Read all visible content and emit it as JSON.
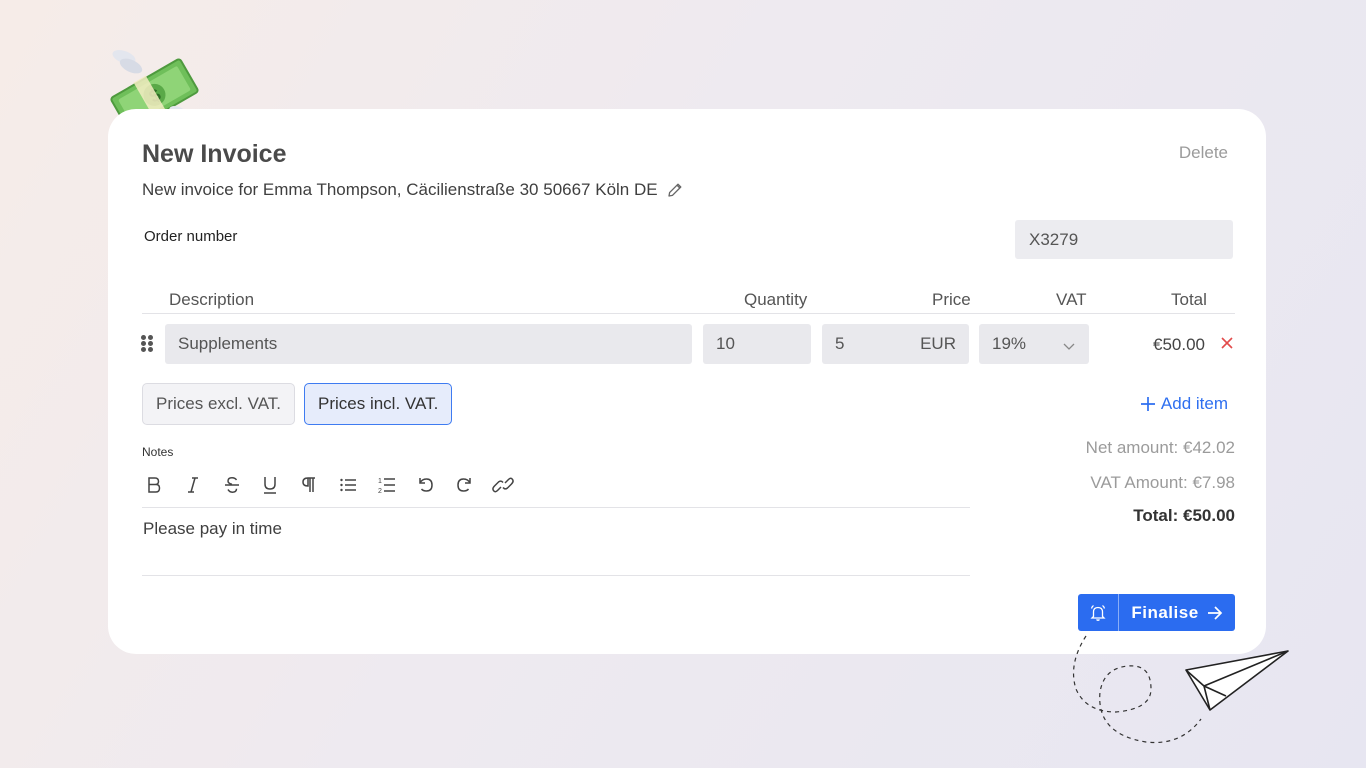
{
  "page": {
    "title": "New Invoice",
    "delete_label": "Delete",
    "subtitle": "New invoice for Emma Thompson, Cäcilienstraße 30 50667 Köln DE",
    "order_label": "Order number",
    "order_value": "X3279"
  },
  "table": {
    "headers": {
      "description": "Description",
      "quantity": "Quantity",
      "price": "Price",
      "vat": "VAT",
      "total": "Total"
    },
    "rows": [
      {
        "description": "Supplements",
        "quantity": "10",
        "price": "5",
        "currency": "EUR",
        "vat": "19%",
        "total": "€50.00"
      }
    ]
  },
  "pricing": {
    "excl_label": "Prices excl. VAT.",
    "incl_label": "Prices incl. VAT.",
    "selected": "incl"
  },
  "add_item_label": "Add item",
  "notes": {
    "label": "Notes",
    "text": "Please pay in time",
    "toolbar": [
      "bold-icon",
      "italic-icon",
      "strikethrough-icon",
      "underline-icon",
      "paragraph-icon",
      "bullet-list-icon",
      "numbered-list-icon",
      "undo-icon",
      "redo-icon",
      "link-icon"
    ]
  },
  "totals": {
    "net": "Net amount: €42.02",
    "vat": "VAT Amount: €7.98",
    "total": "Total: €50.00"
  },
  "finalise_label": "Finalise",
  "colors": {
    "accent": "#2b6cf0",
    "danger": "#e24b4b",
    "field": "#e9e9ed"
  }
}
